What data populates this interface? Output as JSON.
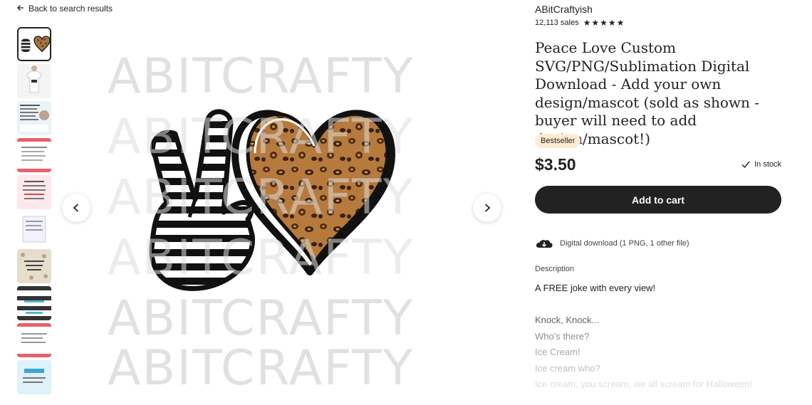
{
  "nav": {
    "back_label": "Back to search results"
  },
  "gallery": {
    "thumbnail_count": 10,
    "watermark_text": "ABITCRAFTY"
  },
  "listing": {
    "shop_name": "ABitCraftyish",
    "sales": "12,113 sales",
    "rating_stars": 5,
    "title": "Peace Love Custom SVG/PNG/Sublimation Digital Download - Add your own design/mascot (sold as shown - buyer will need to add design/mascot!)",
    "badge": "Bestseller",
    "price": "$3.50",
    "stock": "In stock",
    "add_to_cart": "Add to cart",
    "download_info": "Digital download (1 PNG, 1 other file)"
  },
  "description": {
    "heading": "Description",
    "lines": [
      "A FREE joke with every view!",
      "",
      "Knock, Knock...",
      "Who's there?",
      "Ice Cream!",
      "Ice cream who?",
      "Ice cream, you scream, we all scream for Halloween!"
    ]
  },
  "colors": {
    "text": "#222222",
    "button_bg": "#222222",
    "badge_bg": "#fdebd2",
    "watermark": "#dcdcdc"
  }
}
